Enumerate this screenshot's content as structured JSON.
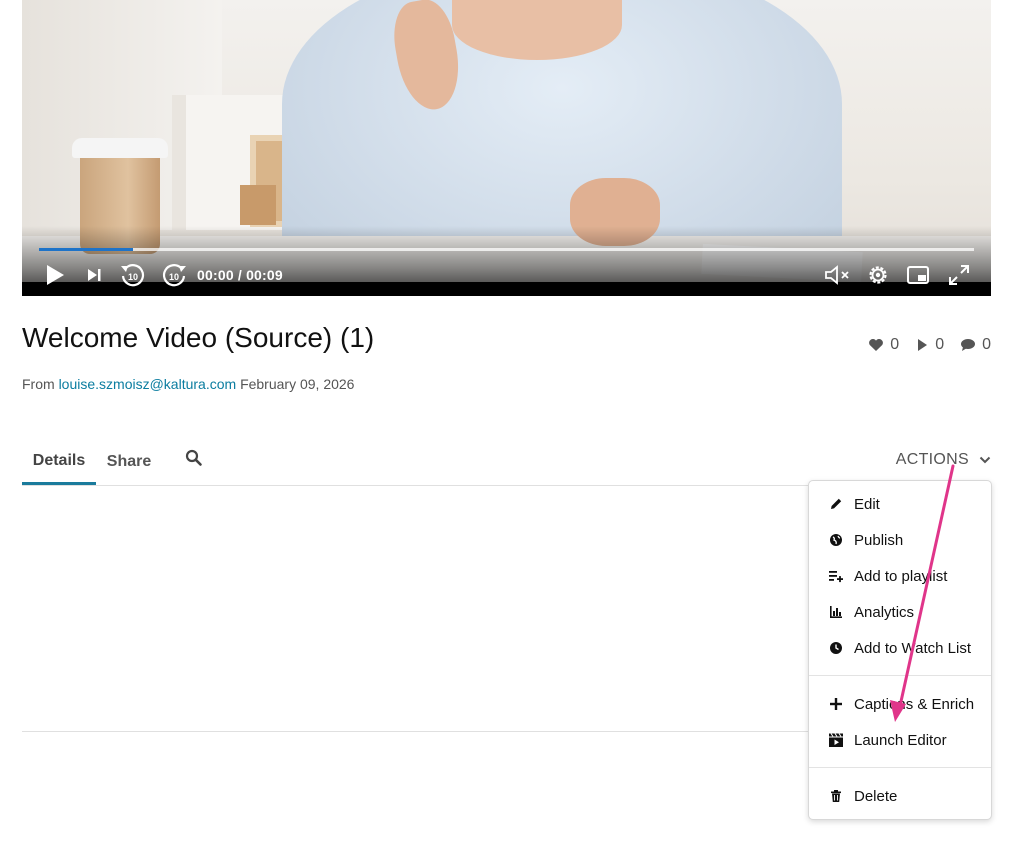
{
  "player": {
    "current_time": "00:00",
    "duration": "00:09",
    "time_display": "00:00 / 00:09",
    "progress_fraction": 0.1,
    "skip_back_seconds": "10",
    "skip_forward_seconds": "10"
  },
  "media": {
    "title": "Welcome Video (Source) (1)",
    "likes": "0",
    "plays": "0",
    "comments": "0",
    "from_label": "From",
    "author": "louise.szmoisz@kaltura.com",
    "date": "February 09, 2026"
  },
  "tabs": [
    {
      "label": "Details",
      "active": true
    },
    {
      "label": "Share",
      "active": false
    }
  ],
  "actions": {
    "label": "ACTIONS",
    "items": [
      {
        "label": "Edit",
        "icon": "pencil-icon"
      },
      {
        "label": "Publish",
        "icon": "globe-icon"
      },
      {
        "label": "Add to playlist",
        "icon": "playlist-add-icon"
      },
      {
        "label": "Analytics",
        "icon": "bar-chart-icon"
      },
      {
        "label": "Add to Watch List",
        "icon": "clock-icon"
      },
      {
        "label": "Captions & Enrich",
        "icon": "plus-icon"
      },
      {
        "label": "Launch Editor",
        "icon": "clapperboard-icon"
      },
      {
        "label": "Delete",
        "icon": "trash-icon"
      }
    ]
  },
  "colors": {
    "accent": "#1a7b9c",
    "link": "#0b7da0",
    "progress": "#1e73c8",
    "annotation_arrow": "#e0358a"
  }
}
